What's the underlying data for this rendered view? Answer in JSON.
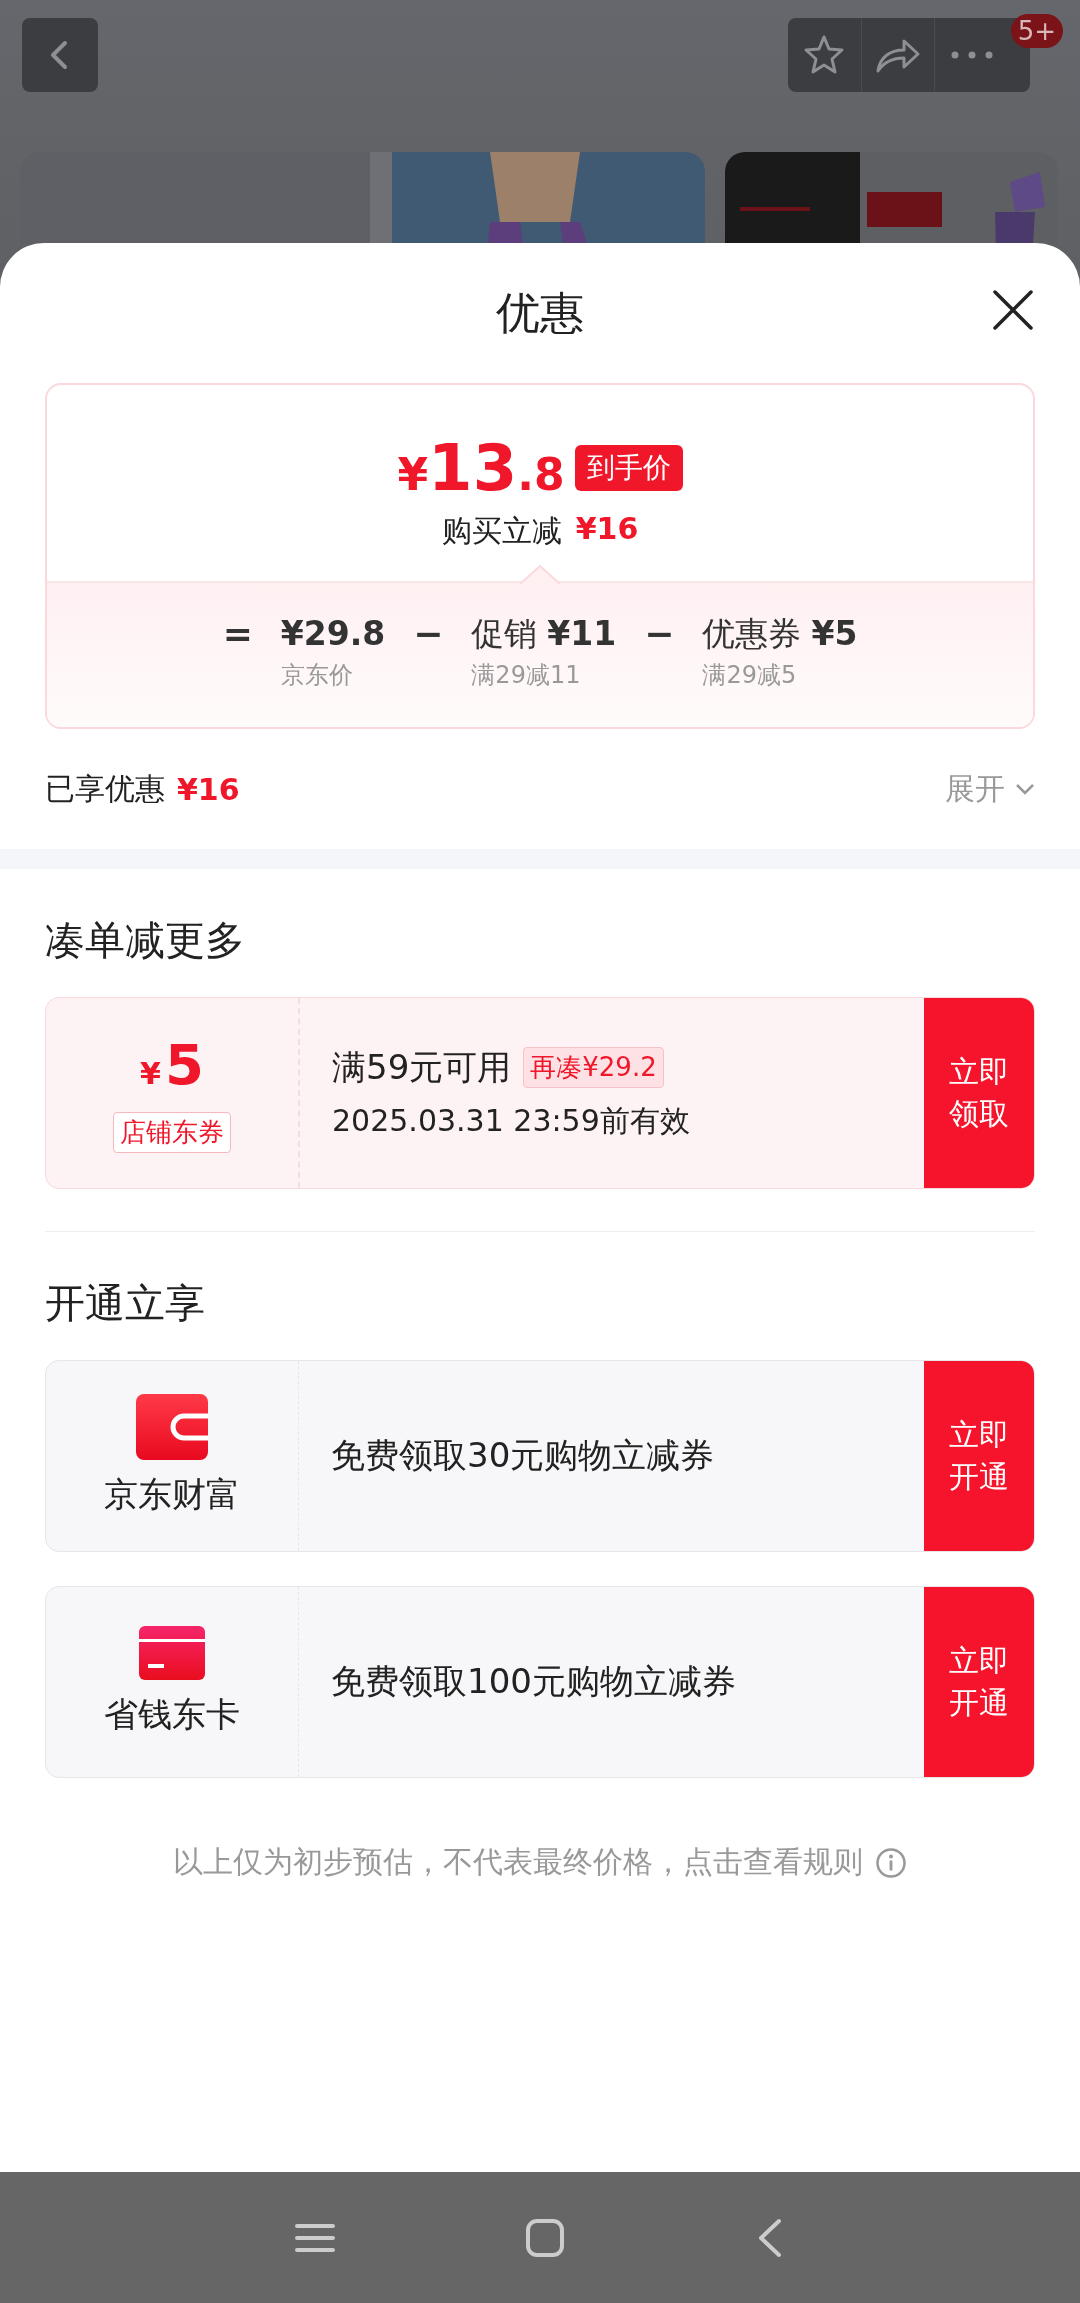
{
  "top_bar": {
    "badge": "5+"
  },
  "sheet": {
    "title": "优惠"
  },
  "price_card": {
    "currency": "¥",
    "price_int": "13",
    "price_dec": ".8",
    "price_tag": "到手价",
    "saving_label": "购买立减",
    "saving_amount": "¥16",
    "formula": [
      {
        "operator": "=",
        "amount": "¥29.8",
        "note": "京东价"
      },
      {
        "operator": "−",
        "label": "促销",
        "amount": "¥11",
        "note": "满29减11"
      },
      {
        "operator": "−",
        "label": "优惠券",
        "amount": "¥5",
        "note": "满29减5"
      }
    ]
  },
  "enjoyed": {
    "label": "已享优惠",
    "amount": "¥16",
    "toggle": "展开",
    "expanded": false
  },
  "sections": [
    {
      "title": "凑单减更多",
      "items": [
        {
          "kind": "coupon",
          "currency": "¥",
          "value": "5",
          "tag": "店铺东券",
          "condition": "满59元可用",
          "hint": "再凑¥29.2",
          "validity": "2025.03.31 23:59前有效",
          "action": "立即领取"
        }
      ]
    },
    {
      "title": "开通立享",
      "items": [
        {
          "kind": "wallet",
          "name": "京东财富",
          "offer": "免费领取30元购物立减券",
          "action": "立即开通"
        },
        {
          "kind": "card",
          "name": "省钱东卡",
          "offer": "免费领取100元购物立减券",
          "action": "立即开通"
        }
      ]
    }
  ],
  "footnote": "以上仅为初步预估，不代表最终价格，点击查看规则"
}
